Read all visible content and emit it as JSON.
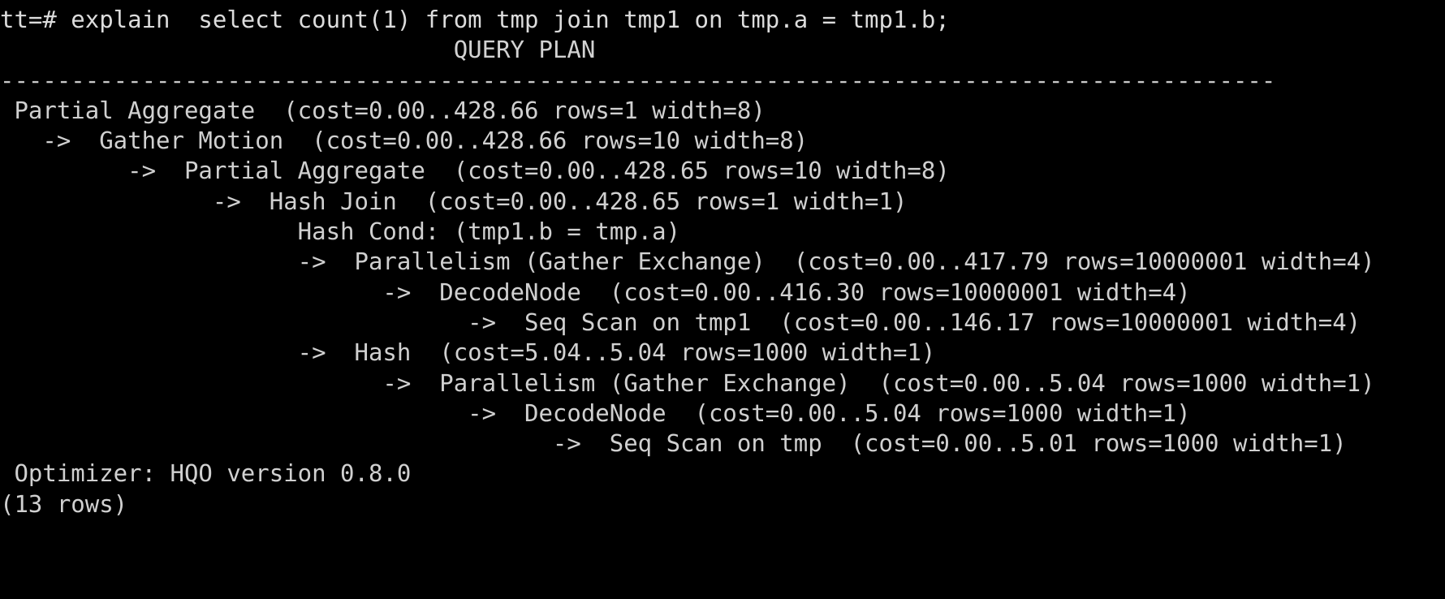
{
  "terminal": {
    "background_color": "#000000",
    "foreground_color": "#d2d2d2",
    "prompt": "tt=# ",
    "command": "explain  select count(1) from tmp join tmp1 on tmp.a = tmp1.b;",
    "prompt_line": "tt=# explain  select count(1) from tmp join tmp1 on tmp.a = tmp1.b;",
    "header": "                                QUERY PLAN",
    "separator": "------------------------------------------------------------------------------------------",
    "plan_lines": [
      " Partial Aggregate  (cost=0.00..428.66 rows=1 width=8)",
      "   ->  Gather Motion  (cost=0.00..428.66 rows=10 width=8)",
      "         ->  Partial Aggregate  (cost=0.00..428.65 rows=10 width=8)",
      "               ->  Hash Join  (cost=0.00..428.65 rows=1 width=1)",
      "                     Hash Cond: (tmp1.b = tmp.a)",
      "                     ->  Parallelism (Gather Exchange)  (cost=0.00..417.79 rows=10000001 width=4)",
      "                           ->  DecodeNode  (cost=0.00..416.30 rows=10000001 width=4)",
      "                                 ->  Seq Scan on tmp1  (cost=0.00..146.17 rows=10000001 width=4)",
      "                     ->  Hash  (cost=5.04..5.04 rows=1000 width=1)",
      "                           ->  Parallelism (Gather Exchange)  (cost=0.00..5.04 rows=1000 width=1)",
      "                                 ->  DecodeNode  (cost=0.00..5.04 rows=1000 width=1)",
      "                                       ->  Seq Scan on tmp  (cost=0.00..5.01 rows=1000 width=1)"
    ],
    "optimizer_line": " Optimizer: HQO version 0.8.0",
    "row_count_line": "(13 rows)",
    "optimizer_name": "HQO",
    "optimizer_version": "0.8.0",
    "row_count": 13
  }
}
